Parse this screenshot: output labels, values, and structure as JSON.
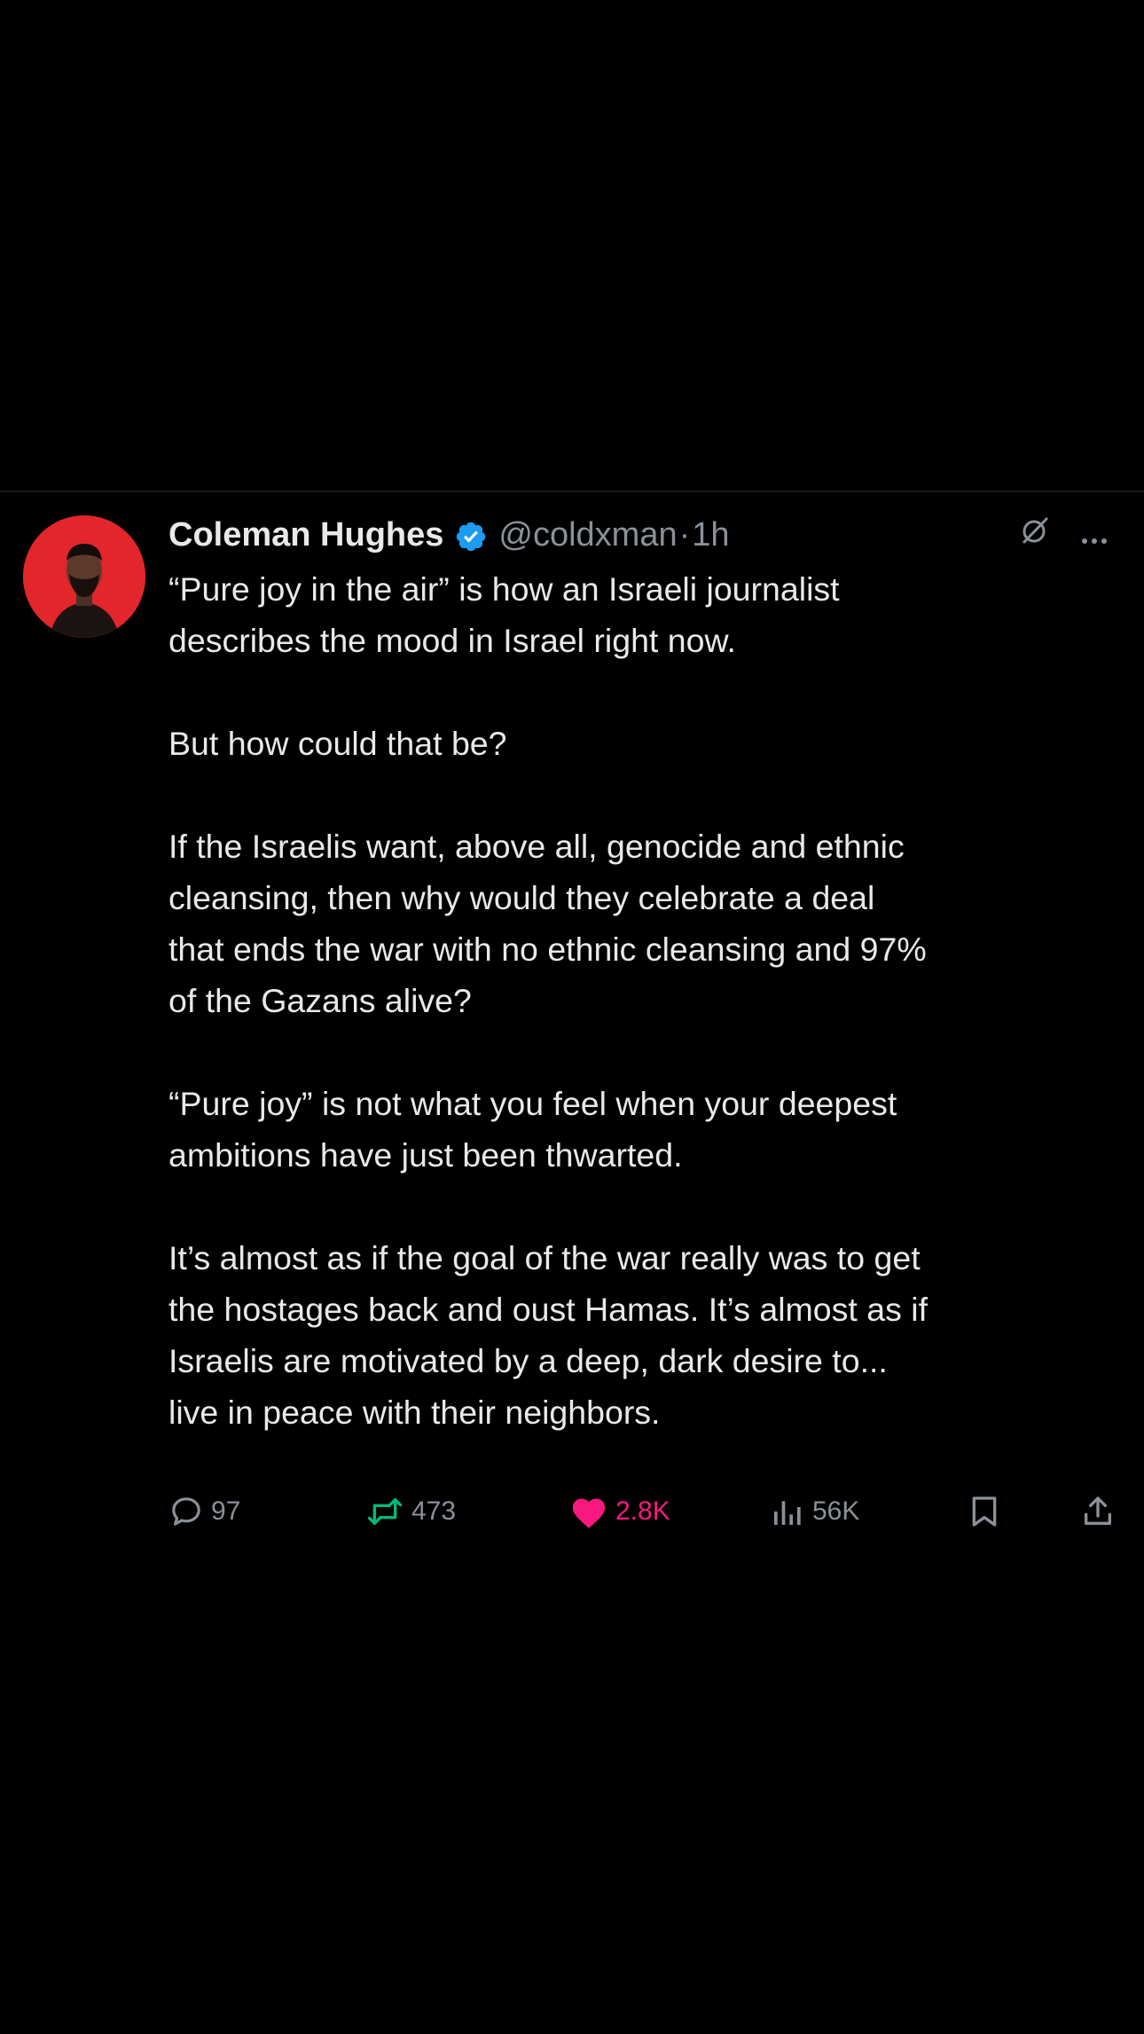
{
  "tweet": {
    "display_name": "Coleman Hughes",
    "handle": "@coldxman",
    "separator": "·",
    "time": "1h",
    "paragraphs": [
      "“Pure joy in the air” is how an Israeli journalist\ndescribes the mood in Israel right now.",
      "But how could that be?",
      "If the Israelis want, above all, genocide and ethnic\ncleansing, then why would they celebrate a deal\nthat ends the war with no ethnic cleansing and 97%\nof the Gazans alive?",
      "“Pure joy” is not what you feel when your deepest\nambitions have just been thwarted.",
      "It’s almost as if the goal of the war really was to get\nthe hostages back and oust Hamas. It’s almost as if\nIsraelis are motivated by a deep, dark desire to...\nlive in peace with their neighbors."
    ],
    "actions": {
      "replies": "97",
      "reposts": "473",
      "likes": "2.8K",
      "views": "56K"
    }
  },
  "icons": {
    "verified": "verified-badge-icon",
    "grok": "grok-icon",
    "more": "more-icon",
    "reply": "reply-icon",
    "retweet": "retweet-icon",
    "like": "heart-icon",
    "views": "views-icon",
    "bookmark": "bookmark-icon",
    "share": "share-icon"
  },
  "colors": {
    "background": "#000000",
    "text": "#e7e9ea",
    "secondary": "#8b9198",
    "verified": "#1d9bf0",
    "liked": "#f91880",
    "retweet": "#00ba7c",
    "avatar_bg": "#e2262b"
  }
}
